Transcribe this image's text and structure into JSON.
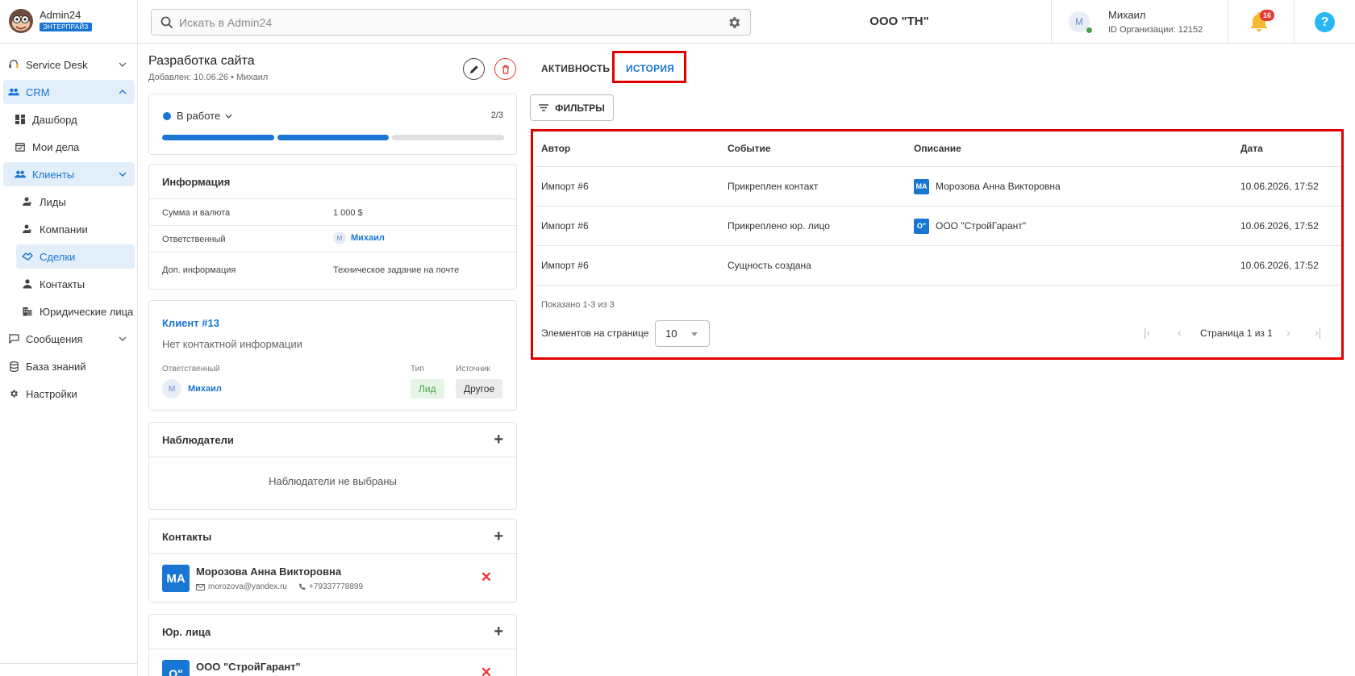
{
  "app": {
    "name": "Admin24",
    "badge": "ЭНТЕРПРАЙЗ",
    "search_placeholder": "Искать в Admin24",
    "org_title": "ООО \"ТН\"",
    "user": {
      "initial": "М",
      "name": "Михаил",
      "org_id": "ID Организации: 12152"
    },
    "notifications_count": "16"
  },
  "sidebar": {
    "items": [
      {
        "label": "Service Desk",
        "icon": "headset-icon"
      },
      {
        "label": "CRM",
        "icon": "people-icon"
      },
      {
        "label": "Дашборд",
        "icon": "dashboard-icon"
      },
      {
        "label": "Мои дела",
        "icon": "calendar-check-icon"
      },
      {
        "label": "Клиенты",
        "icon": "people-icon"
      },
      {
        "label": "Лиды",
        "icon": "person-add-icon"
      },
      {
        "label": "Компании",
        "icon": "person-add-icon"
      },
      {
        "label": "Сделки",
        "icon": "handshake-icon"
      },
      {
        "label": "Контакты",
        "icon": "person-icon"
      },
      {
        "label": "Юридические лица",
        "icon": "building-icon"
      },
      {
        "label": "Сообщения",
        "icon": "chat-icon"
      },
      {
        "label": "База знаний",
        "icon": "database-icon"
      },
      {
        "label": "Настройки",
        "icon": "gear-icon"
      }
    ]
  },
  "deal": {
    "title": "Разработка сайта",
    "subtitle": "Добавлен: 10.06.26 • Михаил",
    "status": "В работе",
    "stage": "2/3",
    "progress_done": 2,
    "progress_total": 3
  },
  "info": {
    "header": "Информация",
    "rows": [
      {
        "key": "Сумма и валюта",
        "value": "1 000 $"
      },
      {
        "key": "Ответственный",
        "value": "Михаил",
        "initial": "М"
      },
      {
        "key": "Доп. информация",
        "value": "Техническое задание на почте"
      }
    ]
  },
  "client": {
    "link": "Клиент #13",
    "no_contact": "Нет контактной информации",
    "resp_label": "Ответственный",
    "resp_initial": "М",
    "resp_name": "Михаил",
    "type_label": "Тип",
    "type_value": "Лид",
    "source_label": "Источник",
    "source_value": "Другое"
  },
  "observers": {
    "header": "Наблюдатели",
    "empty": "Наблюдатели не выбраны"
  },
  "contacts": {
    "header": "Контакты",
    "initials": "МА",
    "name": "Морозова Анна Викторовна",
    "email": "morozova@yandex.ru",
    "phone": "+79337778899"
  },
  "legal": {
    "header": "Юр. лица",
    "initials": "О\"",
    "name": "ООО \"СтройГарант\""
  },
  "tabs": {
    "activity": "АКТИВНОСТЬ",
    "history": "ИСТОРИЯ"
  },
  "filters_label": "ФИЛЬТРЫ",
  "history": {
    "columns": [
      "Автор",
      "Событие",
      "Описание",
      "Дата"
    ],
    "rows": [
      {
        "author": "Импорт #6",
        "event": "Прикреплен контакт",
        "tag": "МА",
        "description": "Морозова Анна Викторовна",
        "date": "10.06.2026, 17:52"
      },
      {
        "author": "Импорт #6",
        "event": "Прикреплено юр. лицо",
        "tag": "О\"",
        "description": "ООО \"СтройГарант\"",
        "date": "10.06.2026, 17:52"
      },
      {
        "author": "Импорт #6",
        "event": "Сущность создана",
        "tag": "",
        "description": "",
        "date": "10.06.2026, 17:52"
      }
    ],
    "shown": "Показано 1-3 из 3",
    "per_page_label": "Элементов на странице",
    "per_page_value": "10",
    "page_label": "Страница 1 из 1"
  },
  "colors": {
    "accent": "#1976d2",
    "danger": "#e53935",
    "highlight": "#e00000"
  }
}
